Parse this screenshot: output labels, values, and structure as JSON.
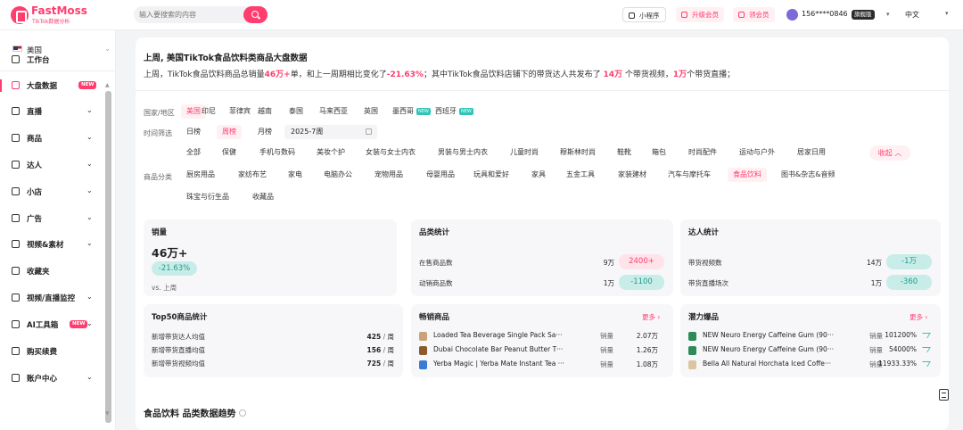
{
  "brand": {
    "name": "FastMoss",
    "sub": "TikTok数据分析",
    "color": "#ff3d6e"
  },
  "search": {
    "placeholder": "输入要搜索的内容"
  },
  "topbar": {
    "mini_program": "小程序",
    "upgrade": "升级会员",
    "coupon": "领会员",
    "user_phone": "156****0846",
    "user_tier": "旗舰版",
    "language": "中文"
  },
  "sidebar": {
    "country": "美国",
    "items": [
      {
        "label": "工作台",
        "icon": "home-icon",
        "dropdown": false
      },
      {
        "label": "大盘数据",
        "icon": "chart-icon",
        "badge": "NEW",
        "active": true
      },
      {
        "label": "直播",
        "icon": "live-icon",
        "dropdown": true
      },
      {
        "label": "商品",
        "icon": "product-icon",
        "dropdown": true
      },
      {
        "label": "达人",
        "icon": "influencer-icon",
        "dropdown": true
      },
      {
        "label": "小店",
        "icon": "shop-icon",
        "dropdown": true
      },
      {
        "label": "广告",
        "icon": "ad-icon",
        "dropdown": true
      },
      {
        "label": "视频&素材",
        "icon": "video-icon",
        "dropdown": true
      },
      {
        "label": "收藏夹",
        "icon": "star-icon",
        "dropdown": false
      },
      {
        "label": "视频/直播监控",
        "icon": "monitor-icon",
        "dropdown": true
      },
      {
        "label": "AI工具箱",
        "icon": "ai-icon",
        "badge": "NEW",
        "dropdown": true
      },
      {
        "label": "购买续费",
        "icon": "diamond-icon",
        "dropdown": false
      },
      {
        "label": "账户中心",
        "icon": "account-icon",
        "dropdown": true
      }
    ]
  },
  "header": {
    "title": "上周, 美国TikTok食品饮料类商品大盘数据",
    "summary": {
      "a": "上周，TikTok食品饮料商品总销量",
      "b": "46万+",
      "c": "单，和上一周期相比变化了",
      "d": "-21.63%",
      "e": "；其中TikTok食品饮料店铺下的带货达人共发布了 ",
      "f": "14万",
      "g": " 个带货视频，",
      "h": "1万",
      "i": "个带货直播；"
    }
  },
  "filters": {
    "country_label": "国家/地区",
    "countries": [
      "美国",
      "印尼",
      "菲律宾",
      "越南",
      "泰国",
      "马来西亚",
      "英国",
      "墨西哥",
      "西班牙"
    ],
    "new_badge": "NEW",
    "time_label": "时间筛选",
    "time_options": [
      "日榜",
      "周榜",
      "月榜"
    ],
    "week_value": "2025-7周",
    "category_label": "商品分类",
    "categories_row1": [
      "全部",
      "保健",
      "手机与数码",
      "美妆个护",
      "女装与女士内衣",
      "男装与男士内衣",
      "儿童时尚",
      "穆斯林时尚",
      "鞋靴",
      "箱包",
      "时尚配件",
      "运动与户外",
      "居家日用"
    ],
    "categories_row2": [
      "厨房用品",
      "家纺布艺",
      "家电",
      "电脑办公",
      "宠物用品",
      "母婴用品",
      "玩具和爱好",
      "家具",
      "五金工具",
      "家装建材",
      "汽车与摩托车",
      "食品饮料",
      "图书&杂志&音频"
    ],
    "categories_row3": [
      "珠宝与衍生品",
      "收藏品"
    ],
    "collapse": "收起"
  },
  "sales_card": {
    "title": "销量",
    "value": "46万+",
    "change": "-21.63%",
    "vs": "vs. 上周"
  },
  "category_card": {
    "title": "品类统计",
    "rows": [
      {
        "label": "在售商品数",
        "value": "9万",
        "delta": "2400+",
        "dir": "up"
      },
      {
        "label": "动销商品数",
        "value": "1万",
        "delta": "-1100",
        "dir": "down"
      }
    ]
  },
  "influencer_card": {
    "title": "达人统计",
    "rows": [
      {
        "label": "带货视频数",
        "value": "14万",
        "delta": "-1万",
        "dir": "down"
      },
      {
        "label": "带货直播场次",
        "value": "1万",
        "delta": "-360",
        "dir": "down"
      }
    ]
  },
  "top50_card": {
    "title": "Top50商品统计",
    "rows": [
      {
        "label": "新增带货达人均值",
        "value": "425",
        "unit": "周"
      },
      {
        "label": "新增带货直播均值",
        "value": "156",
        "unit": "周"
      },
      {
        "label": "新增带货视频均值",
        "value": "725",
        "unit": "周"
      }
    ]
  },
  "bestseller_card": {
    "title": "畅销商品",
    "more": "更多",
    "metric": "销量",
    "items": [
      {
        "name": "Loaded Tea Beverage Single Pack Sa···",
        "value": "2.07万",
        "thumb": "#c9a27a"
      },
      {
        "name": "Dubai Chocolate Bar Peanut Butter T···",
        "value": "1.26万",
        "thumb": "#8a5a2b"
      },
      {
        "name": "Yerba Magic | Yerba Mate Instant Tea ···",
        "value": "1.08万",
        "thumb": "#3a7bd5"
      }
    ]
  },
  "potential_card": {
    "title": "潜力爆品",
    "more": "更多",
    "metric": "销量",
    "items": [
      {
        "name": "NEW Neuro Energy Caffeine Gum (90···",
        "value": "101200%",
        "thumb": "#2e8b57"
      },
      {
        "name": "NEW Neuro Energy Caffeine Gum (90···",
        "value": "54000%",
        "thumb": "#2e8b57"
      },
      {
        "name": "Bella All Natural Horchata Iced Coffe···",
        "value": "11933.33%",
        "thumb": "#d9c5a0"
      }
    ]
  },
  "trend": {
    "title": "食品饮料 品类数据趋势"
  }
}
